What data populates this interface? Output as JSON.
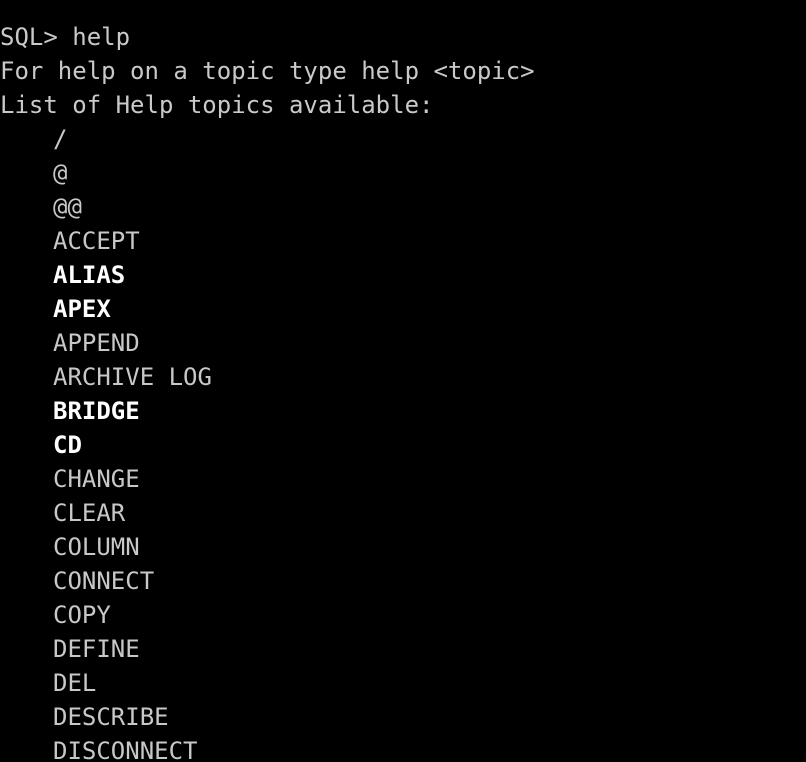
{
  "terminal": {
    "background_color": "#000000",
    "normal_text_color": "#c8c8c8",
    "highlight_text_color": "#ffffff",
    "prompt": "SQL>",
    "command": "help",
    "prompt_line": "SQL> help",
    "help_hint_line": "For help on a topic type help <topic>",
    "list_header_line": "List of Help topics available:"
  },
  "topics": [
    {
      "label": "/",
      "highlighted": false
    },
    {
      "label": "@",
      "highlighted": false
    },
    {
      "label": "@@",
      "highlighted": false
    },
    {
      "label": "ACCEPT",
      "highlighted": false
    },
    {
      "label": "ALIAS",
      "highlighted": true
    },
    {
      "label": "APEX",
      "highlighted": true
    },
    {
      "label": "APPEND",
      "highlighted": false
    },
    {
      "label": "ARCHIVE LOG",
      "highlighted": false
    },
    {
      "label": "BRIDGE",
      "highlighted": true
    },
    {
      "label": "CD",
      "highlighted": true
    },
    {
      "label": "CHANGE",
      "highlighted": false
    },
    {
      "label": "CLEAR",
      "highlighted": false
    },
    {
      "label": "COLUMN",
      "highlighted": false
    },
    {
      "label": "CONNECT",
      "highlighted": false
    },
    {
      "label": "COPY",
      "highlighted": false
    },
    {
      "label": "DEFINE",
      "highlighted": false
    },
    {
      "label": "DEL",
      "highlighted": false
    },
    {
      "label": "DESCRIBE",
      "highlighted": false
    },
    {
      "label": "DISCONNECT",
      "highlighted": false
    }
  ]
}
